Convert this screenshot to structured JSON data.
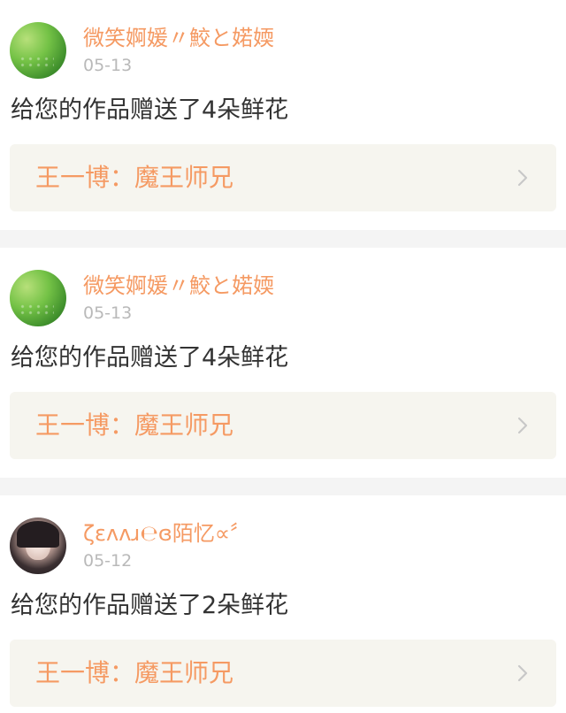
{
  "notifications": [
    {
      "user_name": "微笑婀媛〃鮫と婼媆",
      "date": "05-13",
      "message": "给您的作品赠送了4朵鲜花",
      "work_title": "王一博：魔王师兄",
      "avatar": "green-avatar-icon"
    },
    {
      "user_name": "微笑婀媛〃鮫と婼媆",
      "date": "05-13",
      "message": "给您的作品赠送了4朵鲜花",
      "work_title": "王一博：魔王师兄",
      "avatar": "green-avatar-icon"
    },
    {
      "user_name": "ζεʌʌɹ℮ɞ陌忆∝〞",
      "date": "05-12",
      "message": "给您的作品赠送了2朵鲜花",
      "work_title": "王一博：魔王师兄",
      "avatar": "girl-avatar-icon"
    }
  ],
  "colors": {
    "accent": "#f59a63",
    "date_gray": "#b9b9b9",
    "message_text": "#333333",
    "link_background": "#f6f5ef",
    "separator": "#f4f4f4",
    "chevron": "#c8c8c8"
  }
}
